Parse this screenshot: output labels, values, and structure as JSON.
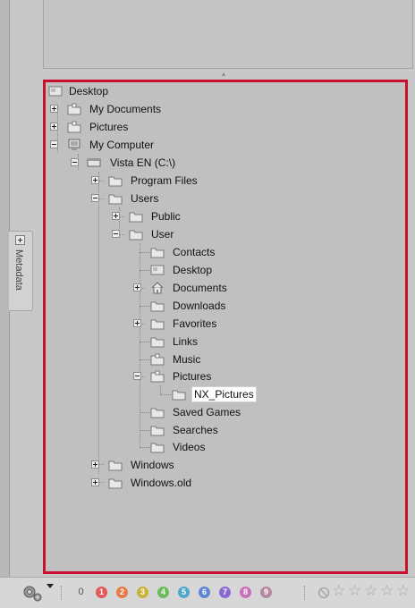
{
  "metadata_tab": {
    "label": "Metadata"
  },
  "tree": {
    "desktop": "Desktop",
    "my_documents": "My Documents",
    "pictures": "Pictures",
    "my_computer": "My Computer",
    "drive": "Vista EN (C:\\)",
    "program_files": "Program Files",
    "users": "Users",
    "public": "Public",
    "user": "User",
    "contacts": "Contacts",
    "user_desktop": "Desktop",
    "documents": "Documents",
    "downloads": "Downloads",
    "favorites": "Favorites",
    "links": "Links",
    "music": "Music",
    "user_pictures": "Pictures",
    "nx_pictures": "NX_Pictures",
    "saved_games": "Saved Games",
    "searches": "Searches",
    "videos": "Videos",
    "windows": "Windows",
    "windows_old": "Windows.old"
  },
  "toolbar": {
    "labels": [
      "0",
      "1",
      "2",
      "3",
      "4",
      "5",
      "6",
      "7",
      "8",
      "9"
    ],
    "label_colors": [
      "",
      "#e05a5a",
      "#e87a4a",
      "#c9b23a",
      "#6dbb5d",
      "#4fa7c9",
      "#5f86d6",
      "#8a6ad0",
      "#c86fb8",
      "#b58aa0"
    ],
    "rating_stars": 5,
    "rating_value": 0
  },
  "colors": {
    "selection_border": "#c8102e"
  }
}
